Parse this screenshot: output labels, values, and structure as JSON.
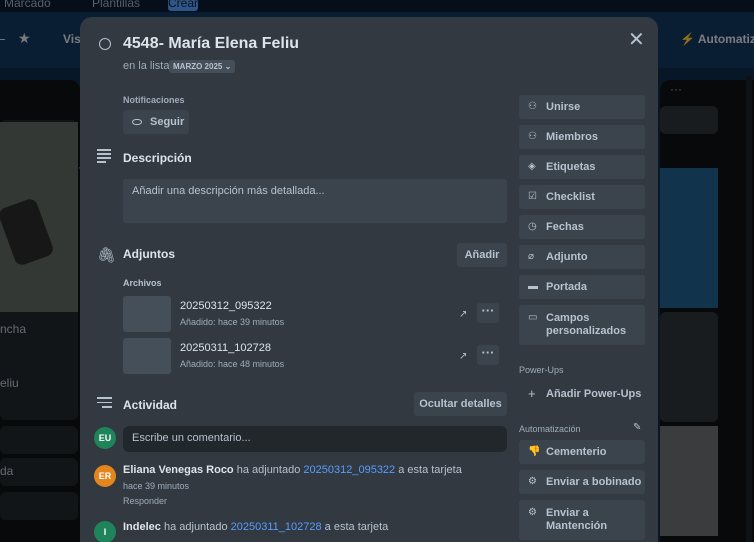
{
  "background": {
    "topbar": {
      "marcado": "Marcado",
      "plantillas": "Plantillas",
      "crear": "Crear"
    },
    "boardbar": {
      "visibility": "Visi",
      "automation": "Automatizaci"
    },
    "left_cards": [
      "ncha",
      "eliu",
      "da"
    ]
  },
  "card": {
    "title": "4548- María Elena Feliu",
    "in_list_prefix": "en la lista",
    "list_name": "MARZO 2025"
  },
  "notifications": {
    "label": "Notificaciones",
    "follow": "Seguir"
  },
  "description": {
    "title": "Descripción",
    "placeholder": "Añadir una descripción más detallada..."
  },
  "attachments": {
    "title": "Adjuntos",
    "add": "Añadir",
    "files_label": "Archivos",
    "files": [
      {
        "name": "20250312_095322",
        "added": "Añadido: hace 39 minutos"
      },
      {
        "name": "20250311_102728",
        "added": "Añadido: hace 48 minutos"
      }
    ]
  },
  "activity": {
    "title": "Actividad",
    "hide_details": "Ocultar detalles",
    "comment_placeholder": "Escribe un comentario...",
    "avatar_user": "EU",
    "entries": [
      {
        "avatar": "ER",
        "user": "Eliana Venegas Roco",
        "action": "ha adjuntado",
        "link": "20250312_095322",
        "suffix": "a esta tarjeta",
        "time": "hace 39 minutos",
        "reply": "Responder"
      },
      {
        "avatar": "I",
        "user": "Indelec",
        "action": "ha adjuntado",
        "link": "20250311_102728",
        "suffix": "a esta tarjeta"
      }
    ]
  },
  "sidebar": {
    "buttons": [
      "Unirse",
      "Miembros",
      "Etiquetas",
      "Checklist",
      "Fechas",
      "Adjunto",
      "Portada"
    ],
    "custom_fields_line1": "Campos",
    "custom_fields_line2": "personalizados",
    "powerups_label": "Power-Ups",
    "add_powerups": "Añadir Power-Ups",
    "automation_label": "Automatización",
    "automation_buttons": [
      "Cementerio",
      "Enviar a bobinado"
    ],
    "send_maint_line1": "Enviar a",
    "send_maint_line2": "Mantención"
  },
  "icons": [
    "eye-icon",
    "description-icon",
    "paperclip-icon",
    "activity-icon",
    "user-icon",
    "members-icon",
    "label-icon",
    "checklist-icon",
    "clock-icon",
    "cover-icon",
    "custom-fields-icon",
    "plus-icon",
    "pencil-icon",
    "thumbs-down-icon",
    "gear-icon",
    "close-icon"
  ]
}
